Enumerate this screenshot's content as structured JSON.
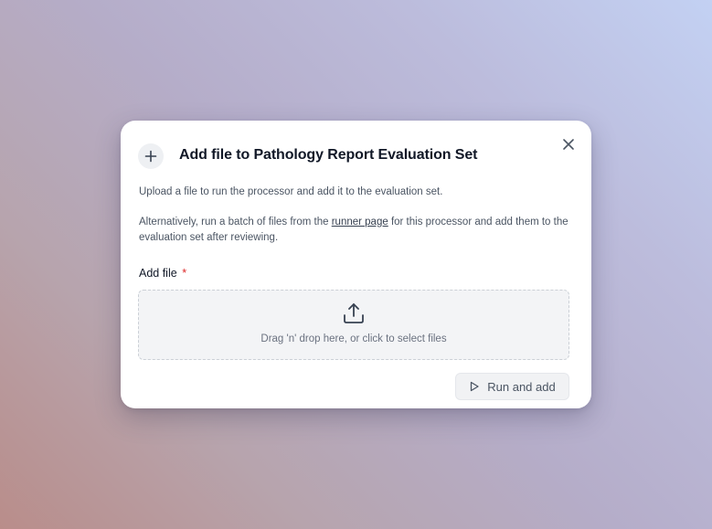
{
  "dialog": {
    "title": "Add file to Pathology Report Evaluation Set",
    "header_icon": "plus-icon",
    "close_icon": "close-icon",
    "description_1": "Upload a file to run the processor and add it to the evaluation set.",
    "description_2_before": "Alternatively, run a batch of files from the ",
    "description_2_link": "runner page",
    "description_2_after": " for this processor and add them to the evaluation set after reviewing.",
    "field_label": "Add file",
    "required_marker": "*",
    "dropzone": {
      "icon": "upload-icon",
      "text": "Drag 'n' drop here, or click to select files"
    },
    "run_button": {
      "icon": "play-icon",
      "label": "Run and add"
    }
  },
  "colors": {
    "required": "#dc2626",
    "title": "#111827",
    "muted": "#6b7280"
  }
}
